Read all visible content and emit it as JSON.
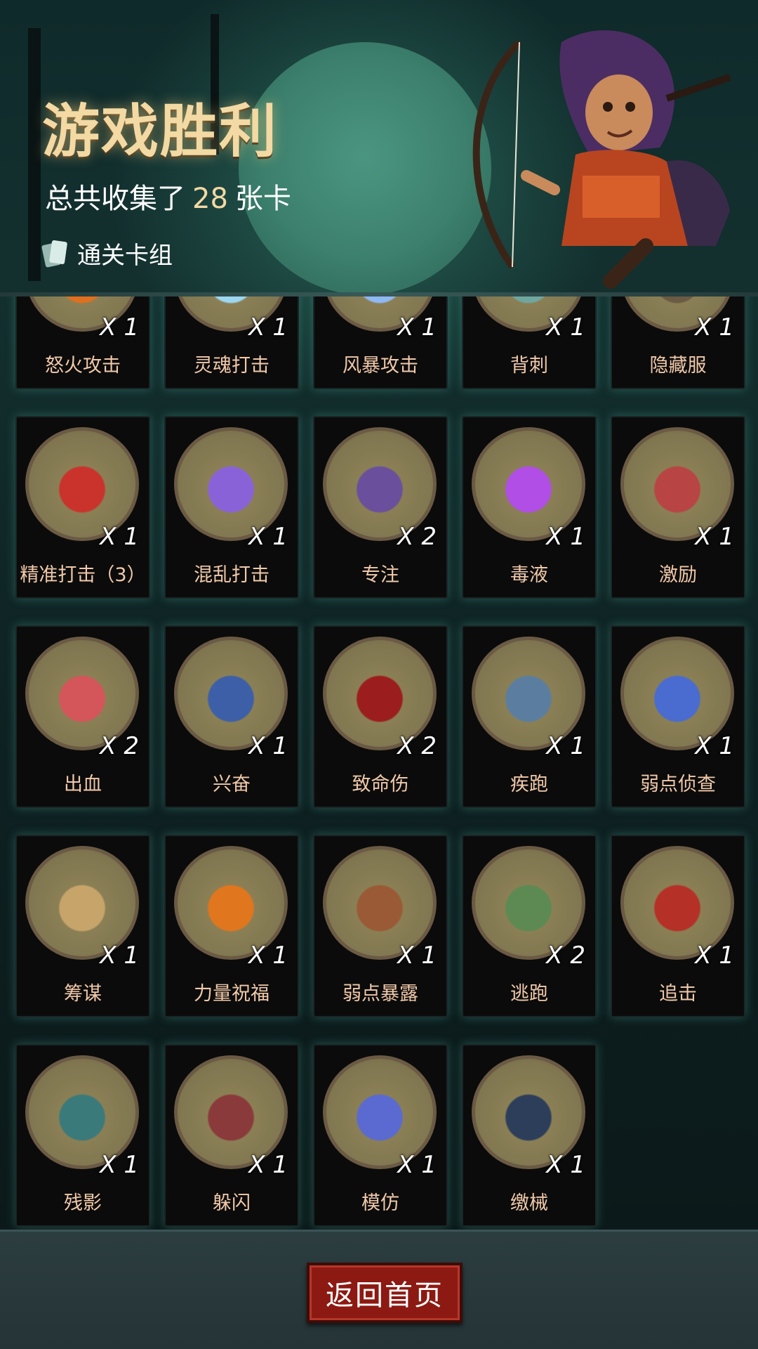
{
  "header": {
    "title": "游戏胜利",
    "subtitle_prefix": "总共收集了",
    "card_total": "28",
    "subtitle_suffix": "张卡",
    "deck_label": "通关卡组"
  },
  "cards": [
    {
      "name": "怒火攻击",
      "count": "X 1",
      "icon": "fire-swirl-icon",
      "color": "#e0701e"
    },
    {
      "name": "灵魂打击",
      "count": "X 1",
      "icon": "ice-shards-icon",
      "color": "#9cd7ef"
    },
    {
      "name": "风暴攻击",
      "count": "X 1",
      "icon": "lightning-icon",
      "color": "#8fb9f3"
    },
    {
      "name": "背刺",
      "count": "X 1",
      "icon": "dagger-back-icon",
      "color": "#6fa7a0"
    },
    {
      "name": "隐藏服",
      "count": "X 1",
      "icon": "cloak-icon",
      "color": "#6b5a44"
    },
    {
      "name": "精准打击（3）",
      "count": "X 1",
      "icon": "target-icon",
      "color": "#c9332c"
    },
    {
      "name": "混乱打击",
      "count": "X 1",
      "icon": "purple-blade-icon",
      "color": "#8a62d8"
    },
    {
      "name": "专注",
      "count": "X 2",
      "icon": "wizard-icon",
      "color": "#6a4f9c"
    },
    {
      "name": "毒液",
      "count": "X 1",
      "icon": "poison-splash-icon",
      "color": "#b04ee6"
    },
    {
      "name": "激励",
      "count": "X 1",
      "icon": "hammer-icon",
      "color": "#b84444"
    },
    {
      "name": "出血",
      "count": "X 2",
      "icon": "octopus-icon",
      "color": "#d4555a"
    },
    {
      "name": "兴奋",
      "count": "X 1",
      "icon": "miner-icon",
      "color": "#3c5fa8"
    },
    {
      "name": "致命伤",
      "count": "X 2",
      "icon": "blood-dagger-icon",
      "color": "#9c1d1d"
    },
    {
      "name": "疾跑",
      "count": "X 1",
      "icon": "werewolf-icon",
      "color": "#5b7ea0"
    },
    {
      "name": "弱点侦查",
      "count": "X 1",
      "icon": "wolf-head-icon",
      "color": "#4a6bd0"
    },
    {
      "name": "筹谋",
      "count": "X 1",
      "icon": "map-icon",
      "color": "#c7a46a"
    },
    {
      "name": "力量祝福",
      "count": "X 1",
      "icon": "fist-icon",
      "color": "#e0761e"
    },
    {
      "name": "弱点暴露",
      "count": "X 1",
      "icon": "boot-icon",
      "color": "#9a5a35"
    },
    {
      "name": "逃跑",
      "count": "X 2",
      "icon": "running-man-icon",
      "color": "#5c8a52"
    },
    {
      "name": "追击",
      "count": "X 1",
      "icon": "red-hood-icon",
      "color": "#b53026"
    },
    {
      "name": "残影",
      "count": "X 1",
      "icon": "hooded-crowd-icon",
      "color": "#3b7a7a"
    },
    {
      "name": "躲闪",
      "count": "X 1",
      "icon": "girl-dodge-icon",
      "color": "#8a3a3a"
    },
    {
      "name": "模仿",
      "count": "X 1",
      "icon": "goblin-face-icon",
      "color": "#5a6ad0"
    },
    {
      "name": "缴械",
      "count": "X 1",
      "icon": "diamond-banner-icon",
      "color": "#2c3e5a"
    }
  ],
  "home_button_label": "返回首页"
}
